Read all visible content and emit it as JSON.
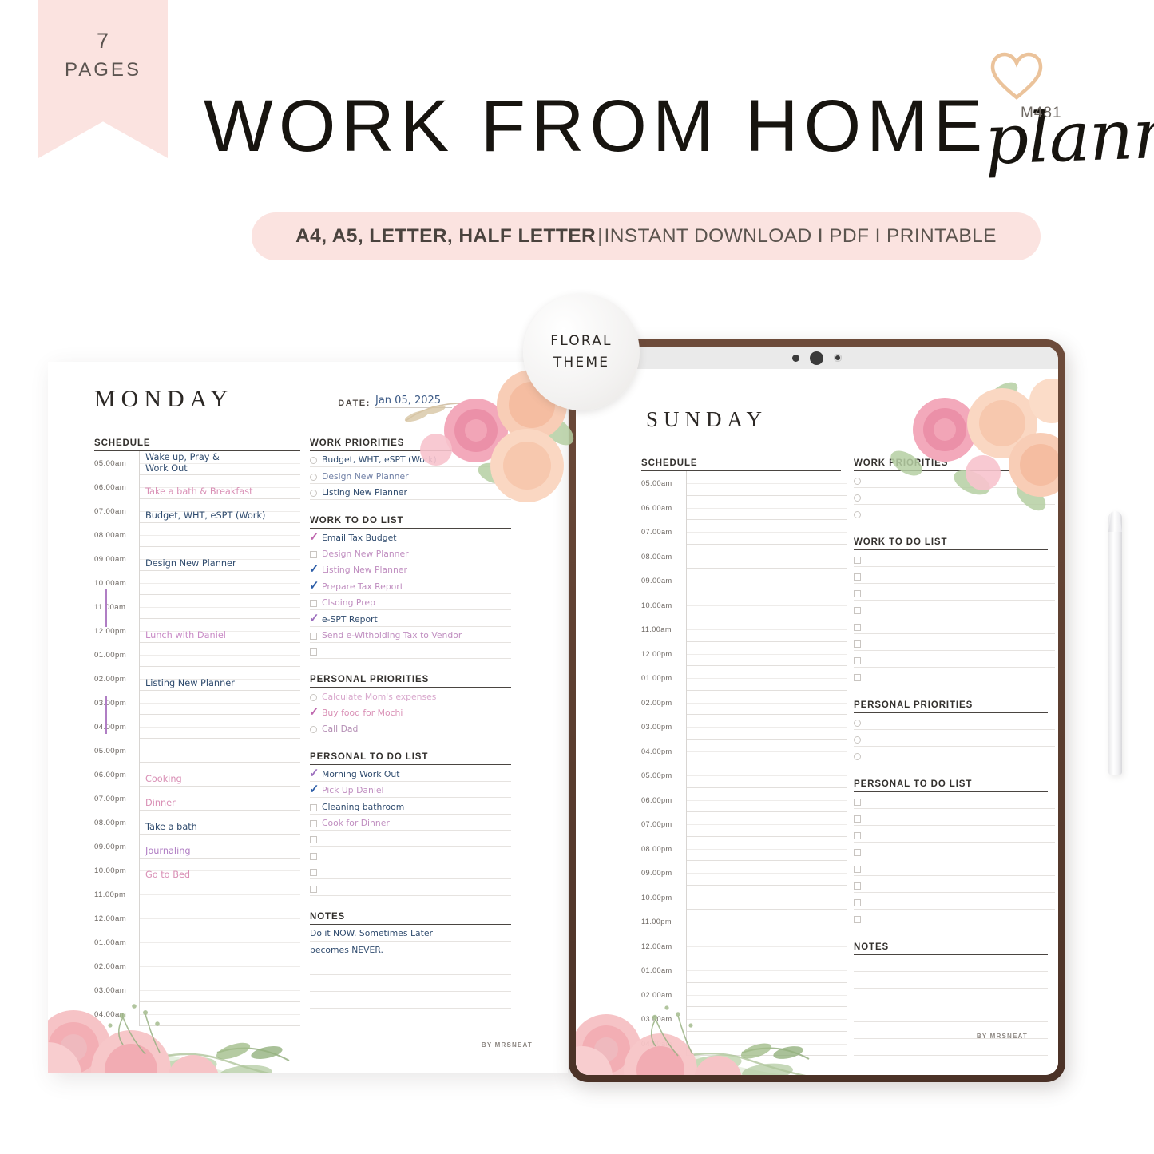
{
  "promo": {
    "pages_count": "7",
    "pages_label": "PAGES",
    "title_main": "WORK FROM HOME",
    "title_script": "planner",
    "sku": "M481",
    "formats": "A4, A5, LETTER, HALF LETTER",
    "separator": "|",
    "details": "INSTANT DOWNLOAD I PDF I PRINTABLE",
    "theme_badge_line1": "FLORAL",
    "theme_badge_line2": "THEME",
    "brand": "BY MRSNEAT"
  },
  "colors": {
    "blush": "#fbe3e0",
    "ink": "#17140f",
    "pen_blue": "#2f4b6e",
    "pen_pink": "#d98fb5",
    "pen_purple": "#9c6fbe",
    "tablet_frame": "#5a3d2f"
  },
  "labels": {
    "date": "DATE:",
    "schedule": "SCHEDULE",
    "work_priorities": "WORK PRIORITIES",
    "work_todo": "WORK TO DO LIST",
    "personal_priorities": "PERSONAL PRIORITIES",
    "personal_todo": "PERSONAL TO DO LIST",
    "notes": "NOTES"
  },
  "times": [
    "05.00am",
    "06.00am",
    "07.00am",
    "08.00am",
    "09.00am",
    "10.00am",
    "11.00am",
    "12.00pm",
    "01.00pm",
    "02.00pm",
    "03.00pm",
    "04.00pm",
    "05.00pm",
    "06.00pm",
    "07.00pm",
    "08.00pm",
    "09.00pm",
    "10.00pm",
    "11.00pm",
    "12.00am",
    "01.00am",
    "02.00am",
    "03.00am",
    "04.00am"
  ],
  "monday": {
    "day": "MONDAY",
    "date_value": "Jan 05, 2025",
    "schedule_entries": [
      {
        "time": "05.00am",
        "text": "Wake up, Pray &",
        "text2": "Work Out",
        "color": "#2f4b6e"
      },
      {
        "time": "06.00am",
        "text": "Take a bath & Breakfast",
        "color": "#d98fb5"
      },
      {
        "time": "07.00am",
        "text": "Budget, WHT, eSPT (Work)",
        "color": "#2f4b6e"
      },
      {
        "time": "09.00am",
        "text": "Design New Planner",
        "color": "#2f4b6e"
      },
      {
        "time": "12.00pm",
        "text": "Lunch with Daniel",
        "color": "#c98bc6"
      },
      {
        "time": "02.00pm",
        "text": "Listing New Planner",
        "color": "#2f4b6e"
      },
      {
        "time": "06.00pm",
        "text": "Cooking",
        "color": "#d98fb5"
      },
      {
        "time": "07.00pm",
        "text": "Dinner",
        "color": "#d98fb5"
      },
      {
        "time": "08.00pm",
        "text": "Take a bath",
        "color": "#2f4b6e"
      },
      {
        "time": "09.00pm",
        "text": "Journaling",
        "color": "#b07ec4"
      },
      {
        "time": "10.00pm",
        "text": "Go to Bed",
        "color": "#d98fb5"
      }
    ],
    "work_priorities": [
      {
        "text": "Budget, WHT, eSPT (Work)",
        "checked": false,
        "color": "#2f4b6e"
      },
      {
        "text": "Design New Planner",
        "checked": false,
        "color": "#6f7fa5"
      },
      {
        "text": "Listing New Planner",
        "checked": false,
        "color": "#2f4b6e"
      }
    ],
    "work_todo": [
      {
        "text": "Email Tax Budget",
        "checked": true,
        "tick": "#c06ab0",
        "color": "#2f4b6e"
      },
      {
        "text": "Design New Planner",
        "checked": false,
        "color": "#c08ec0"
      },
      {
        "text": "Listing New Planner",
        "checked": true,
        "tick": "#2f5fa8",
        "color": "#c08ec0"
      },
      {
        "text": "Prepare Tax Report",
        "checked": true,
        "tick": "#2f5fa8",
        "color": "#c08ec0"
      },
      {
        "text": "Clsoing Prep",
        "checked": false,
        "color": "#c08ec0"
      },
      {
        "text": "e-SPT Report",
        "checked": true,
        "tick": "#9c6fbe",
        "color": "#2f4b6e"
      },
      {
        "text": "Send e-Witholding Tax to Vendor",
        "checked": false,
        "color": "#c08ec0"
      },
      {
        "text": "",
        "checked": false,
        "color": "#2f4b6e"
      }
    ],
    "personal_priorities": [
      {
        "text": "Calculate Mom's expenses",
        "checked": false,
        "color": "#d9a8cd"
      },
      {
        "text": "Buy food for Mochi",
        "checked": true,
        "tick": "#c06ab0",
        "color": "#d98fb5"
      },
      {
        "text": "Call Dad",
        "checked": false,
        "color": "#b58fb5"
      }
    ],
    "personal_todo": [
      {
        "text": "Morning Work Out",
        "checked": true,
        "tick": "#9c6fbe",
        "color": "#2f4b6e"
      },
      {
        "text": "Pick Up Daniel",
        "checked": true,
        "tick": "#2f5fa8",
        "color": "#c08ec0"
      },
      {
        "text": "Cleaning bathroom",
        "checked": false,
        "color": "#2f4b6e"
      },
      {
        "text": "Cook for Dinner",
        "checked": false,
        "color": "#c08ec0"
      },
      {
        "text": "",
        "checked": false,
        "color": "#2f4b6e"
      },
      {
        "text": "",
        "checked": false,
        "color": "#2f4b6e"
      },
      {
        "text": "",
        "checked": false,
        "color": "#2f4b6e"
      },
      {
        "text": "",
        "checked": false,
        "color": "#2f4b6e"
      }
    ],
    "notes": [
      "Do it NOW. Sometimes Later",
      "becomes NEVER."
    ],
    "notes_blank_lines": 4
  },
  "sunday": {
    "day": "SUNDAY",
    "date_value": "",
    "schedule_entries": [],
    "work_priorities_count": 3,
    "work_todo_count": 8,
    "personal_priorities_count": 3,
    "personal_todo_count": 8,
    "notes_blank_lines": 6
  }
}
